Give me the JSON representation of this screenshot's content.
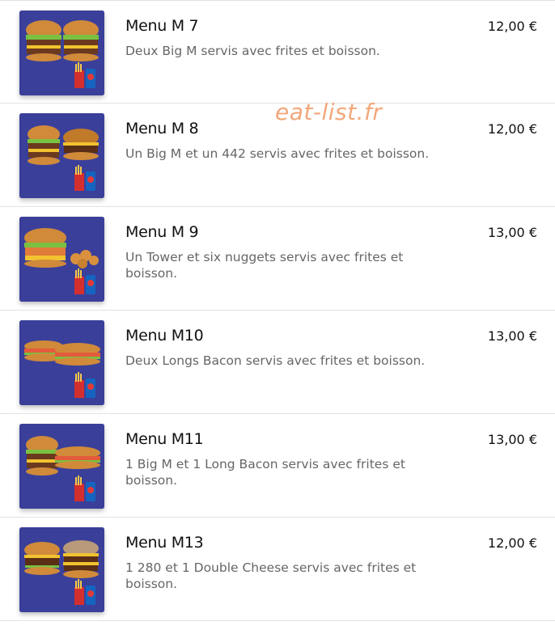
{
  "watermark": "eat-list.fr",
  "menu": [
    {
      "title": "Menu M 7",
      "description": "Deux Big M servis avec frites et boisson.",
      "price": "12,00 €"
    },
    {
      "title": "Menu M 8",
      "description": "Un Big M et un 442 servis avec frites et boisson.",
      "price": "12,00 €"
    },
    {
      "title": "Menu M 9",
      "description": "Un Tower et six nuggets servis avec frites et boisson.",
      "price": "13,00 €"
    },
    {
      "title": "Menu M10",
      "description": "Deux Longs Bacon servis avec frites et boisson.",
      "price": "13,00 €"
    },
    {
      "title": "Menu M11",
      "description": "1 Big M et 1 Long Bacon servis avec frites et boisson.",
      "price": "13,00 €"
    },
    {
      "title": "Menu M13",
      "description": "1 280 et 1 Double Cheese servis avec frites et boisson.",
      "price": "12,00 €"
    }
  ],
  "colors": {
    "thumb_bg": "#3a3f9a",
    "watermark": "#f2a77a",
    "divider": "#e2e2e2"
  },
  "icons": [
    "burger-image",
    "fries-icon",
    "drink-cup-icon"
  ]
}
